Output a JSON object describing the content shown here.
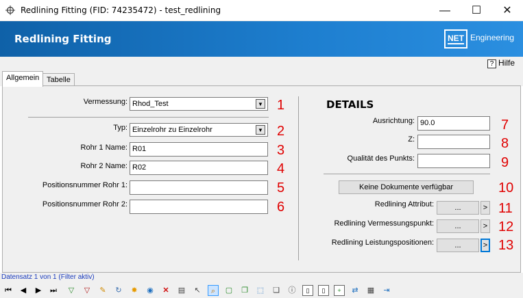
{
  "window": {
    "title": "Redlining Fitting (FID: 74235472) - test_redlining",
    "minimize": "—",
    "maximize": "☐",
    "close": "✕"
  },
  "banner": {
    "title": "Redlining Fitting",
    "logo_mark": "NET",
    "logo_text": "Engineering"
  },
  "help": {
    "icon": "?",
    "label": "Hilfe"
  },
  "tabs": [
    {
      "label": "Allgemein",
      "active": true
    },
    {
      "label": "Tabelle",
      "active": false
    }
  ],
  "form": {
    "vermessung": {
      "label": "Vermessung:",
      "value": "Rhod_Test",
      "marker": "1"
    },
    "typ": {
      "label": "Typ:",
      "value": "Einzelrohr zu Einzelrohr",
      "marker": "2"
    },
    "rohr1_name": {
      "label": "Rohr 1 Name:",
      "value": "R01",
      "marker": "3"
    },
    "rohr2_name": {
      "label": "Rohr 2 Name:",
      "value": "R02",
      "marker": "4"
    },
    "positionsnummer_rohr1": {
      "label": "Positionsnummer Rohr 1:",
      "value": "",
      "marker": "5"
    },
    "positionsnummer_rohr2": {
      "label": "Positionsnummer Rohr 2:",
      "value": "",
      "marker": "6"
    }
  },
  "details": {
    "heading": "DETAILS",
    "ausrichtung": {
      "label": "Ausrichtung:",
      "value": "90.0",
      "marker": "7"
    },
    "z": {
      "label": "Z:",
      "value": "",
      "marker": "8"
    },
    "qualitaet": {
      "label": "Qualität des Punkts:",
      "value": "",
      "marker": "9"
    },
    "dokumente_button": {
      "label": "Keine Dokumente verfügbar",
      "marker": "10"
    },
    "redlining_attribut": {
      "label": "Redlining Attribut:",
      "button": "...",
      "arrow": ">",
      "marker": "11"
    },
    "redlining_vermessungspunkt": {
      "label": "Redlining Vermessungspunkt:",
      "button": "...",
      "arrow": ">",
      "marker": "12"
    },
    "redlining_leistungspositionen": {
      "label": "Redlining Leistungspositionen:",
      "button": "...",
      "arrow": ">",
      "marker": "13"
    }
  },
  "status": {
    "text": "Datensatz 1 von 1 (Filter aktiv)"
  },
  "toolbar_icons": [
    "first-record-icon",
    "prev-record-icon",
    "next-record-icon",
    "last-record-icon",
    "add-filter-icon",
    "filter-icon",
    "edit-icon",
    "refresh-icon",
    "highlight-icon",
    "globe-icon",
    "delete-icon",
    "print-icon",
    "select-icon",
    "zoom-icon",
    "layer-icon",
    "copy-icon",
    "select-box-icon",
    "duplicate-icon",
    "info-icon",
    "attachment-icon",
    "document-icon",
    "add-image-icon",
    "split-icon",
    "table-icon",
    "exit-icon"
  ],
  "colors": {
    "banner_start": "#0f61a8",
    "banner_end": "#2b8fe0",
    "marker": "#e00000",
    "status_text": "#1a3bbd"
  }
}
